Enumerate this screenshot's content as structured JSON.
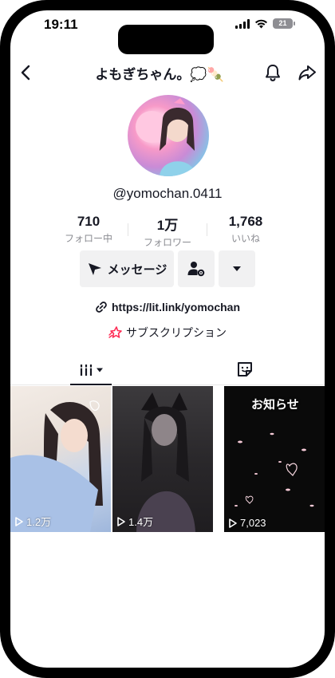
{
  "status_bar": {
    "time": "19:11",
    "battery": "21"
  },
  "header": {
    "title": "よもぎちゃん。💭🍡"
  },
  "profile": {
    "username": "@yomochan.0411"
  },
  "stats": [
    {
      "value": "710",
      "label": "フォロー中"
    },
    {
      "value": "1万",
      "label": "フォロワー"
    },
    {
      "value": "1,768",
      "label": "いいね"
    }
  ],
  "actions": {
    "message_label": "メッセージ"
  },
  "bio": {
    "link": "https://lit.link/yomochan",
    "subscription": "サブスクリプション"
  },
  "videos": [
    {
      "views": "1.2万"
    },
    {
      "views": "1.4万"
    },
    {
      "views": "7,023",
      "overlay_text": "お知らせ"
    }
  ],
  "colors": {
    "text": "#161823",
    "muted": "#8a8b91",
    "button_bg": "#f1f1f2",
    "accent": "#fe2c55"
  }
}
